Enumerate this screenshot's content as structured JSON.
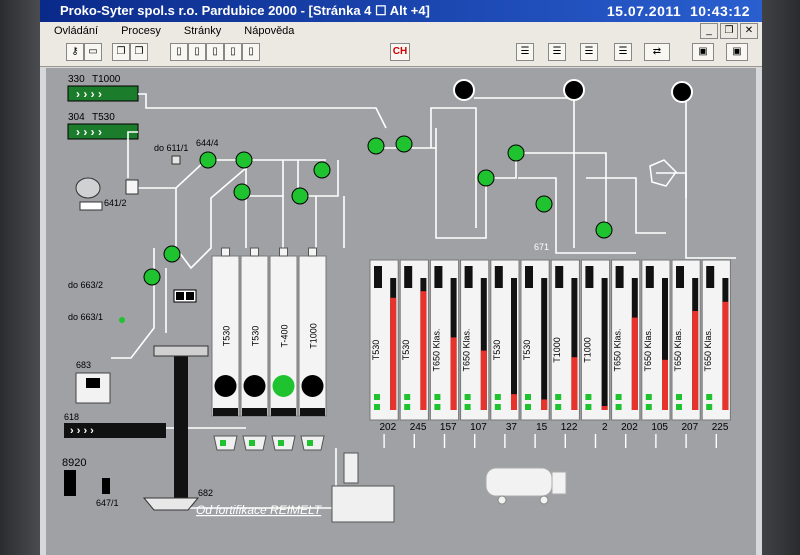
{
  "window": {
    "title": "Proko-Syter spol.s r.o. Pardubice 2000 - [Stránka 4 ☐ Alt +4]",
    "date": "15.07.2011",
    "time": "10:43:12"
  },
  "menu": [
    "Ovládání",
    "Procesy",
    "Stránky",
    "Nápověda"
  ],
  "toolbar": {
    "alarm_label": "CH"
  },
  "feeds": {
    "feed1_code": "330",
    "feed1_name": "T1000",
    "feed2_code": "304",
    "feed2_name": "T530",
    "arrows": "› › › ›"
  },
  "labels": {
    "do611": "do 611/1",
    "v644": "644/4",
    "v641": "641/2",
    "do663_2": "do 663/2",
    "do663_1": "do 663/1",
    "n683": "683",
    "n618": "618",
    "n8920": "8920",
    "n647": "647/1",
    "n682": "682",
    "n671": "671",
    "fortif": "Od fortifikace REIMELT"
  },
  "left_silos": [
    {
      "name": "T530"
    },
    {
      "name": "T530"
    },
    {
      "name": "T-400"
    },
    {
      "name": "T1000"
    }
  ],
  "right_silos": [
    {
      "name": "T530",
      "value": "202",
      "level": 0.85
    },
    {
      "name": "T530",
      "value": "245",
      "level": 0.9
    },
    {
      "name": "T650 Klas.",
      "value": "157",
      "level": 0.55
    },
    {
      "name": "T650 Klas.",
      "value": "107",
      "level": 0.45
    },
    {
      "name": "T530",
      "value": "37",
      "level": 0.12
    },
    {
      "name": "T530",
      "value": "15",
      "level": 0.08
    },
    {
      "name": "T1000",
      "value": "122",
      "level": 0.4
    },
    {
      "name": "T1000",
      "value": "2",
      "level": 0.03
    },
    {
      "name": "T650 Klas.",
      "value": "202",
      "level": 0.7
    },
    {
      "name": "T650 Klas.",
      "value": "105",
      "level": 0.38
    },
    {
      "name": "T650 Klas.",
      "value": "207",
      "level": 0.75
    },
    {
      "name": "T650 Klas.",
      "value": "225",
      "level": 0.82
    }
  ],
  "colors": {
    "active": "#1fc32f",
    "level": "#e8322c",
    "canvas": "#9fa1a4"
  }
}
